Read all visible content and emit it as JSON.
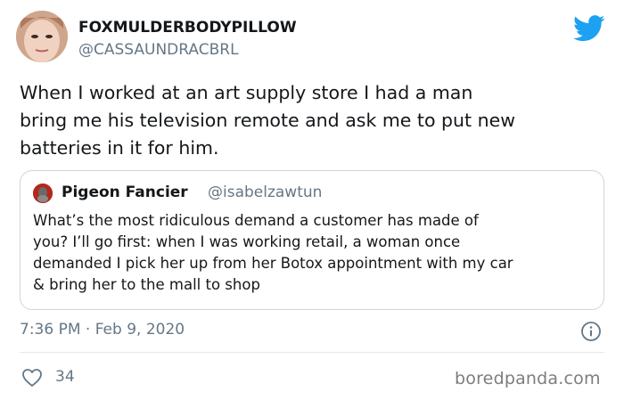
{
  "author": {
    "display_name": "FOXMULDERBODYPILLOW",
    "handle": "@CASSAUNDRACBRL"
  },
  "tweet": {
    "text": "When I worked at an art supply store I had a man\nbring me his television remote and ask me to put new\nbatteries in it for him.",
    "timestamp": "7:36 PM · Feb 9, 2020",
    "likes": "34"
  },
  "quoted_tweet": {
    "display_name": "Pigeon Fancier",
    "handle": "@isabelzawtun",
    "text": "What’s the most ridiculous demand a customer has made of\nyou? I’ll go first: when I was working retail, a woman once\ndemanded I pick her up from her Botox appointment with my car\n& bring her to the mall to shop"
  },
  "watermark": "boredpanda.com",
  "colors": {
    "twitter_blue": "#1da1f2",
    "secondary_text": "#657786",
    "border": "#ccd6dd"
  },
  "icons": {
    "logo": "twitter-bird-icon",
    "info": "info-icon",
    "like": "heart-icon"
  }
}
